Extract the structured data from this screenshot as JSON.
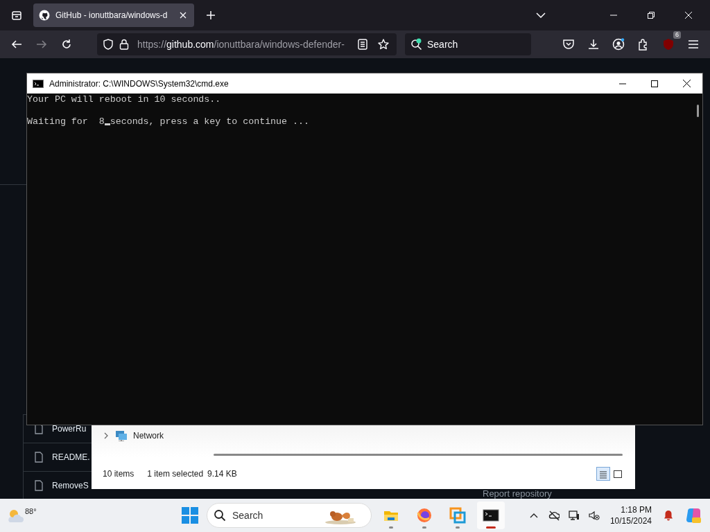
{
  "browser": {
    "tab": {
      "title": "GitHub - ionuttbara/windows-d",
      "selected": true
    },
    "nav": [
      {
        "kind": "back",
        "disabled": false
      },
      {
        "kind": "forward",
        "disabled": true
      },
      {
        "kind": "reload",
        "disabled": false
      }
    ],
    "address": {
      "scheme": "https://",
      "host": "github.com",
      "path": "/ionuttbara/windows-defender-"
    },
    "search": {
      "placeholder": "Search"
    },
    "extension_badge": "6"
  },
  "github": {
    "files": [
      {
        "name": "PowerRu"
      },
      {
        "name": "README."
      },
      {
        "name": "RemoveS"
      }
    ],
    "sidebar_link": "Report repository"
  },
  "cmd": {
    "title": "Administrator: C:\\WINDOWS\\System32\\cmd.exe",
    "lines": [
      {
        "text": "Your PC will reboot in 10 seconds..",
        "cursor": false
      },
      {
        "text": "Waiting for  8",
        "cursor": true,
        "after": "seconds, press a key to continue ..."
      }
    ]
  },
  "explorer": {
    "tree": [
      {
        "label": "Network",
        "expanded": false
      }
    ],
    "status": {
      "item_count": "10 items",
      "selection": "1 item selected",
      "size": "9.14 KB"
    },
    "views": [
      {
        "kind": "details",
        "selected": true
      },
      {
        "kind": "tiles",
        "selected": false
      }
    ]
  },
  "taskbar": {
    "weather": "88°",
    "search": {
      "placeholder": "Search"
    },
    "apps": [
      {
        "kind": "explorer",
        "active": false
      },
      {
        "kind": "firefox",
        "active": false
      },
      {
        "kind": "vm",
        "active": false
      },
      {
        "kind": "terminal",
        "active": true
      }
    ],
    "time": "1:18 PM",
    "date": "10/15/2024"
  }
}
